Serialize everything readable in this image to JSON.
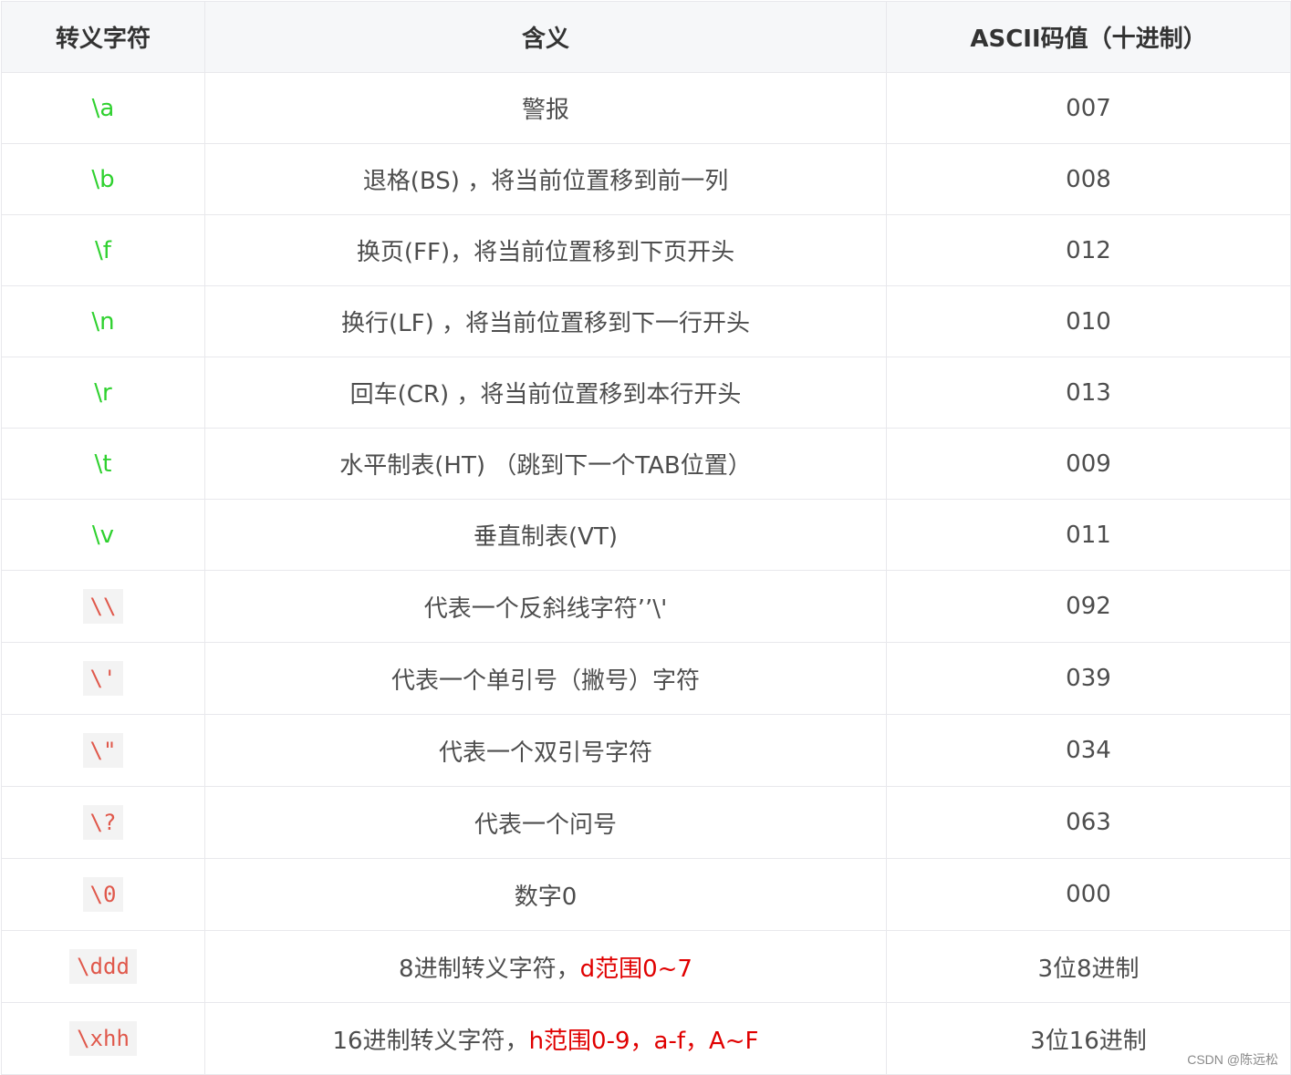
{
  "table": {
    "headers": [
      "转义字符",
      "含义",
      "ASCII码值（十进制）"
    ],
    "rows": [
      {
        "escape": "\\a",
        "meaning": "警报",
        "meaning_red": "",
        "ascii": "007"
      },
      {
        "escape": "\\b",
        "meaning": "退格(BS) ，将当前位置移到前一列",
        "meaning_red": "",
        "ascii": "008"
      },
      {
        "escape": "\\f",
        "meaning": "换页(FF)，将当前位置移到下页开头",
        "meaning_red": "",
        "ascii": "012"
      },
      {
        "escape": "\\n",
        "meaning": "换行(LF) ，将当前位置移到下一行开头",
        "meaning_red": "",
        "ascii": "010"
      },
      {
        "escape": "\\r",
        "meaning": "回车(CR) ，将当前位置移到本行开头",
        "meaning_red": "",
        "ascii": "013"
      },
      {
        "escape": "\\t",
        "meaning": "水平制表(HT) （跳到下一个TAB位置）",
        "meaning_red": "",
        "ascii": "009"
      },
      {
        "escape": "\\v",
        "meaning": "垂直制表(VT)",
        "meaning_red": "",
        "ascii": "011"
      },
      {
        "escape": "\\\\",
        "meaning": "代表一个反斜线字符’’\\'",
        "meaning_red": "",
        "ascii": "092"
      },
      {
        "escape": "\\'",
        "meaning": "代表一个单引号（撇号）字符",
        "meaning_red": "",
        "ascii": "039"
      },
      {
        "escape": "\\\"",
        "meaning": "代表一个双引号字符",
        "meaning_red": "",
        "ascii": "034"
      },
      {
        "escape": "\\?",
        "meaning": "代表一个问号",
        "meaning_red": "",
        "ascii": "063"
      },
      {
        "escape": "\\0",
        "meaning": "数字0",
        "meaning_red": "",
        "ascii": "000"
      },
      {
        "escape": "\\ddd",
        "meaning": "8进制转义字符，",
        "meaning_red": "d范围0~7",
        "ascii": "3位8进制"
      },
      {
        "escape": "\\xhh",
        "meaning": "16进制转义字符，",
        "meaning_red": "h范围0-9，a-f，A~F",
        "ascii": "3位16进制"
      }
    ]
  },
  "watermark": "CSDN @陈远松",
  "colors": {
    "escape_green": "#2fd12f",
    "escape_code": "#e0584b",
    "highlight_red": "#e00000",
    "header_bg": "#f6f7f9"
  }
}
